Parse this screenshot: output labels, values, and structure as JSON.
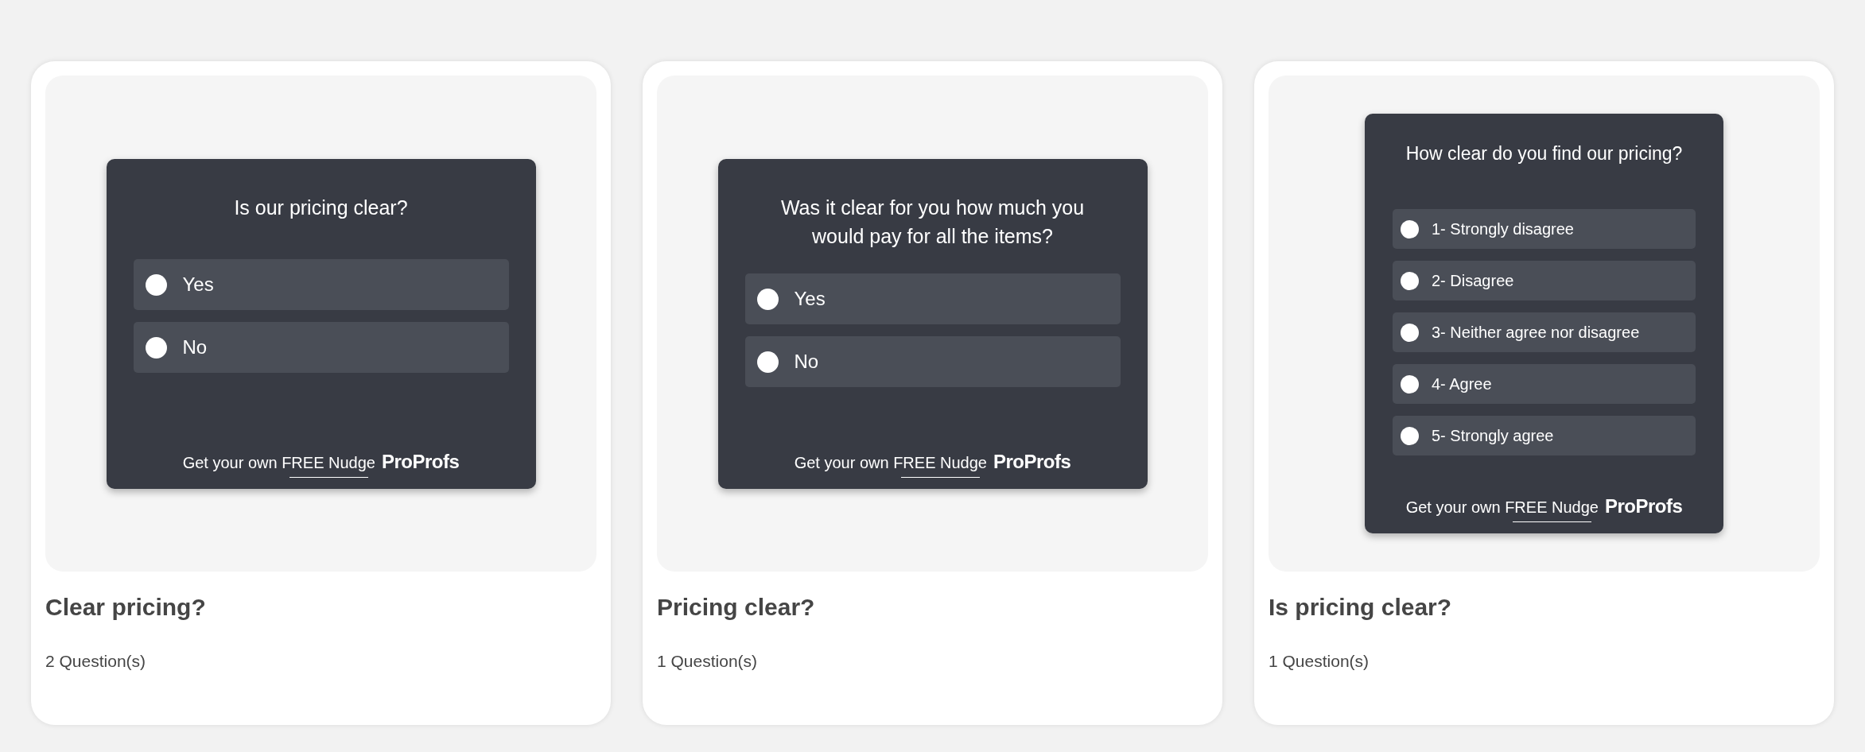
{
  "cards": [
    {
      "widget": {
        "kind": "yes_no",
        "question": "Is our pricing clear?",
        "options": [
          {
            "label": "Yes",
            "selected": false
          },
          {
            "label": "No",
            "selected": false
          }
        ],
        "footer": {
          "text": "Get your own",
          "link": "FREE Nudge",
          "brand": "ProProfs"
        }
      },
      "title": "Clear pricing?",
      "count": "2 Question(s)"
    },
    {
      "widget": {
        "kind": "yes_no",
        "question": "Was it clear for you how much you would pay for all the items?",
        "options": [
          {
            "label": "Yes",
            "selected": false
          },
          {
            "label": "No",
            "selected": false
          }
        ],
        "footer": {
          "text": "Get your own",
          "link": "FREE Nudge",
          "brand": "ProProfs"
        }
      },
      "title": "Pricing clear?",
      "count": "1 Question(s)"
    },
    {
      "widget": {
        "kind": "scale",
        "question": "How clear do you find our pricing?",
        "options": [
          {
            "label": "1- Strongly disagree",
            "selected": false
          },
          {
            "label": "2- Disagree",
            "selected": false
          },
          {
            "label": "3- Neither agree nor disagree",
            "selected": false
          },
          {
            "label": "4- Agree",
            "selected": false
          },
          {
            "label": "5- Strongly agree",
            "selected": false
          }
        ],
        "footer": {
          "text": "Get your own",
          "link": "FREE Nudge",
          "brand": "ProProfs"
        }
      },
      "title": "Is pricing clear?",
      "count": "1 Question(s)"
    }
  ]
}
